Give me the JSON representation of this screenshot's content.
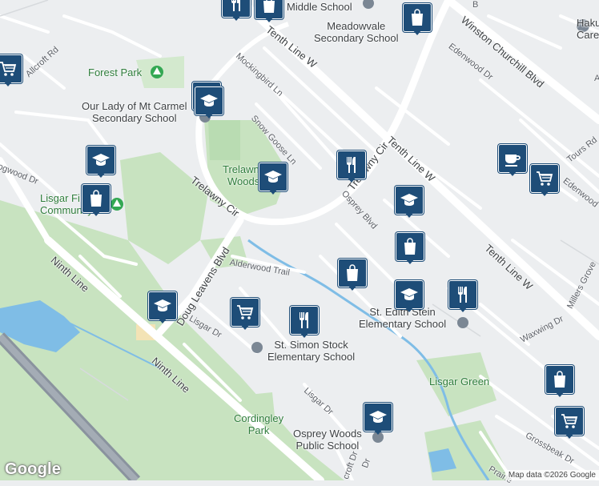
{
  "colors": {
    "land": "#eceef0",
    "park": "#c8e3c0",
    "park_dark": "#a8d4a0",
    "water": "#7fbde6",
    "road": "#ffffff",
    "highway": "#8a939e",
    "pin": "#1e4d78",
    "park_text": "#2f7d3c"
  },
  "roads": {
    "tenth_line_w_top": "Tenth Line W",
    "tenth_line_w_mid": "Tenth Line W",
    "tenth_line_w_low": "Tenth Line W",
    "winston_churchill": "Winston Churchill Blvd",
    "edenwood_dr": "Edenwood Dr",
    "edenwood_right": "Edenwood",
    "mockingbird": "Mockingbird Ln",
    "snow_goose": "Snow Goose Ln",
    "trelawny_cir_left": "Trelawny Cir",
    "trelawny_cir_right": "Trelawny Cir",
    "osprey_blvd": "Osprey Blvd",
    "allcroft_rd": "Allcroft Rd",
    "wedgwood_dr": "ogwood Dr",
    "ninth_line_upper": "Ninth Line",
    "ninth_line_lower": "Ninth Line",
    "doug_leavens": "Doug Leavens Blvd",
    "alderwood_trail": "Alderwood Trail",
    "lisgar_dr_left": "Lisgar Dr",
    "lisgar_dr_lower": "Lisgar Dr",
    "tours_rd": "Tours Rd",
    "millers_grove": "Millers Grove",
    "waxwing_dr": "Waxwing Dr",
    "grossbeak_dr": "Grossbeak Dr",
    "prairie": "Prairie",
    "croft_dr": "croft Dr",
    "dr_small": "Dr",
    "corner_b": "B",
    "corner_a": "A"
  },
  "parks": {
    "forest_park": "Forest Park",
    "trelawny_woods_1": "Trelawny",
    "trelawny_woods_2": "Woods",
    "lisgar_fields_1": "Lisgar Fi",
    "lisgar_fields_2": "Community P",
    "lisgar_green": "Lisgar Green",
    "cordingley_1": "Cordingley",
    "cordingley_2": "Park"
  },
  "pois": {
    "middle_school": "Middle School",
    "meadowvale_1": "Meadowvale",
    "meadowvale_2": "Secondary School",
    "our_lady_1": "Our Lady of Mt Carmel",
    "our_lady_2": "Secondary School",
    "st_edith_1": "St. Edith Stein",
    "st_edith_2": "Elementary School",
    "st_simon_1": "St. Simon Stock",
    "st_simon_2": "Elementary School",
    "osprey_woods_1": "Osprey Woods",
    "osprey_woods_2": "Public School",
    "hakuna_1": "Haku",
    "hakuna_2": "Care"
  },
  "markers": [
    {
      "name": "restaurant-marker",
      "icon": "fork-knife-icon"
    },
    {
      "name": "shopping-bag-marker",
      "icon": "shopping-bag-icon"
    },
    {
      "name": "shopping-bag-marker",
      "icon": "shopping-bag-icon"
    },
    {
      "name": "grocery-cart-marker",
      "icon": "shopping-cart-icon"
    },
    {
      "name": "school-marker",
      "icon": "graduation-cap-icon"
    },
    {
      "name": "school-marker",
      "icon": "graduation-cap-icon"
    },
    {
      "name": "school-marker",
      "icon": "graduation-cap-icon"
    },
    {
      "name": "restaurant-marker",
      "icon": "fork-knife-icon"
    },
    {
      "name": "school-marker",
      "icon": "graduation-cap-icon"
    },
    {
      "name": "grocery-cart-marker",
      "icon": "shopping-cart-icon"
    },
    {
      "name": "cafe-marker",
      "icon": "coffee-cup-icon"
    },
    {
      "name": "shopping-bag-marker",
      "icon": "shopping-bag-icon"
    },
    {
      "name": "school-marker",
      "icon": "graduation-cap-icon"
    },
    {
      "name": "shopping-bag-marker",
      "icon": "shopping-bag-icon"
    },
    {
      "name": "shopping-bag-marker",
      "icon": "shopping-bag-icon"
    },
    {
      "name": "school-marker",
      "icon": "graduation-cap-icon"
    },
    {
      "name": "restaurant-marker",
      "icon": "fork-knife-icon"
    },
    {
      "name": "school-marker",
      "icon": "graduation-cap-icon"
    },
    {
      "name": "grocery-cart-marker",
      "icon": "shopping-cart-icon"
    },
    {
      "name": "restaurant-marker",
      "icon": "fork-knife-icon"
    },
    {
      "name": "shopping-bag-marker",
      "icon": "shopping-bag-icon"
    },
    {
      "name": "school-marker",
      "icon": "graduation-cap-icon"
    },
    {
      "name": "grocery-cart-marker",
      "icon": "shopping-cart-icon"
    }
  ],
  "google_logo": "Google",
  "attribution": "Map data ©2026 Google"
}
